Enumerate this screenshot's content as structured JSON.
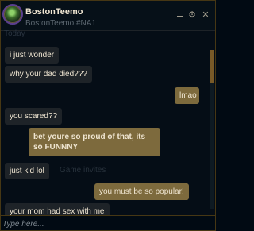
{
  "header": {
    "name": "BostonTeemo",
    "tag": "BostonTeemo #NA1",
    "minimize_icon": "minimize-icon",
    "gear_icon": "gear-icon",
    "close_icon": "close-icon",
    "close_glyph": "✕",
    "gear_glyph": "⚙"
  },
  "faded": {
    "top": "Today",
    "middle": "Game invites"
  },
  "messages": [
    {
      "from": "them",
      "text": "i just wonder"
    },
    {
      "from": "them",
      "text": "why your dad died???"
    },
    {
      "from": "me",
      "text": "lmao"
    },
    {
      "from": "them",
      "text": "you scared??"
    },
    {
      "from": "me",
      "text": "bet youre so proud of that, its so FUNNNY"
    },
    {
      "from": "them",
      "text": "just kid lol"
    },
    {
      "from": "me",
      "text": "you must be so popular!"
    },
    {
      "from": "them",
      "text": "your mom had sex with me"
    }
  ],
  "input": {
    "placeholder": "Type here..."
  },
  "colors": {
    "accent_gold": "#785a28",
    "my_bubble": "#7d6a3d",
    "their_bubble": "#1e2328"
  }
}
